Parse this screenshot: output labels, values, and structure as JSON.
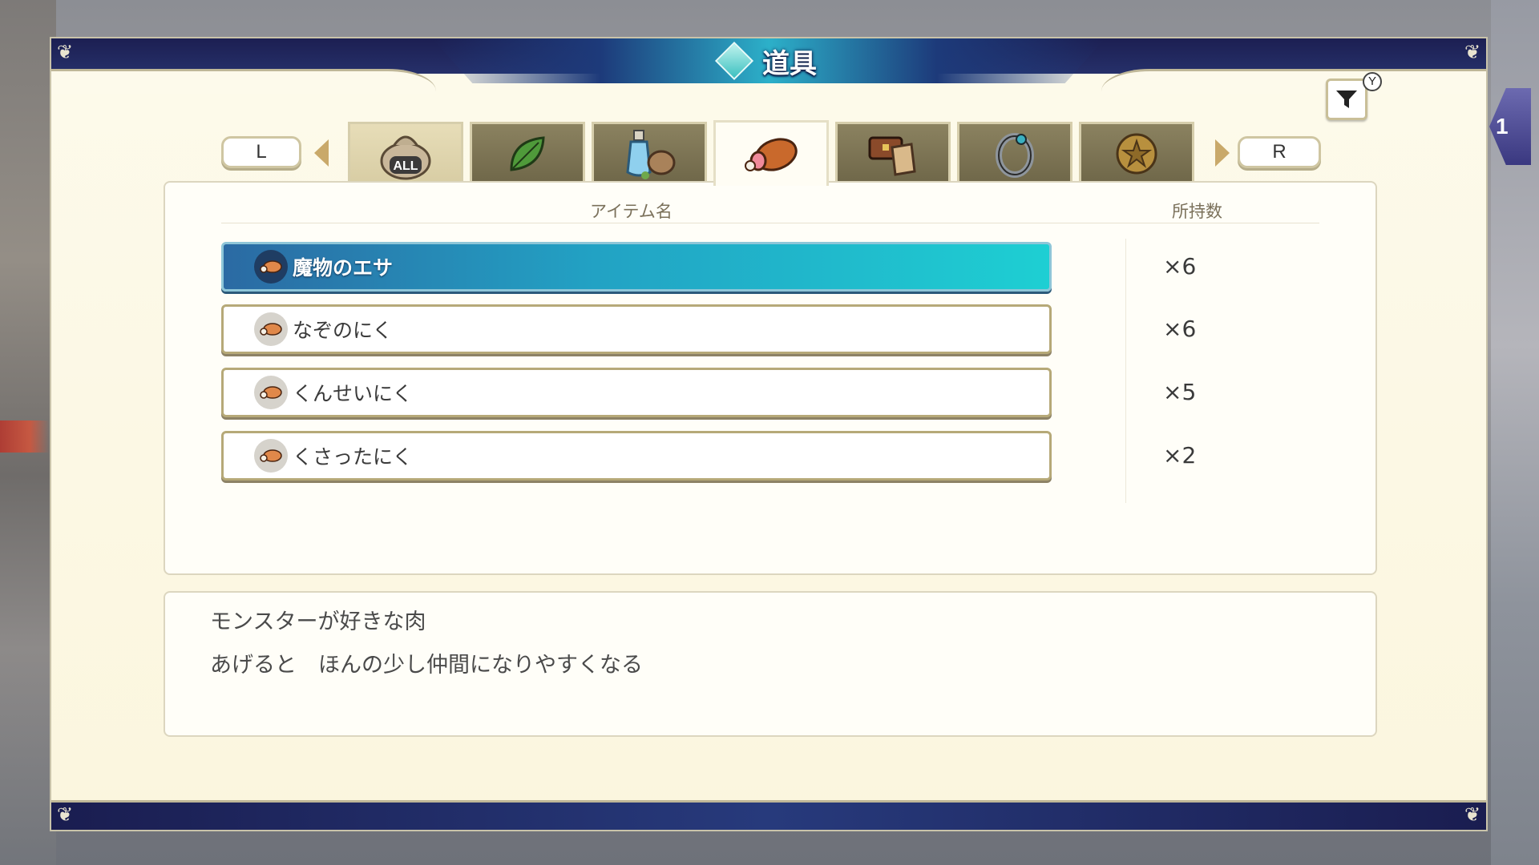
{
  "window": {
    "title": "道具"
  },
  "side_indicator": {
    "label": "1"
  },
  "filter": {
    "icon": "filter-icon",
    "button_hint": "Y"
  },
  "tabs": {
    "left_label": "L",
    "right_label": "R",
    "items": [
      {
        "name": "all",
        "icon": "bag-all-icon",
        "text": "ALL"
      },
      {
        "name": "herb",
        "icon": "leaf-icon"
      },
      {
        "name": "potion",
        "icon": "potion-bottle-icon"
      },
      {
        "name": "meat",
        "icon": "meat-icon",
        "active": true
      },
      {
        "name": "treasure",
        "icon": "chest-scroll-icon"
      },
      {
        "name": "ring",
        "icon": "ring-icon"
      },
      {
        "name": "medal",
        "icon": "star-medal-icon"
      }
    ]
  },
  "list": {
    "col_name": "アイテム名",
    "col_qty": "所持数",
    "items": [
      {
        "name": "魔物のエサ",
        "qty": "×6",
        "selected": true
      },
      {
        "name": "なぞのにく",
        "qty": "×6"
      },
      {
        "name": "くんせいにく",
        "qty": "×5"
      },
      {
        "name": "くさったにく",
        "qty": "×2"
      }
    ]
  },
  "description": {
    "line1": "モンスターが好きな肉",
    "line2": "あげると　ほんの少し仲間になりやすくなる"
  },
  "colors": {
    "frame_navy": "#1c1f52",
    "selected_teal": "#1ecfd3",
    "parchment": "#fdfaeb",
    "tab_inactive": "#7d7555",
    "row_border": "#b6a978"
  }
}
